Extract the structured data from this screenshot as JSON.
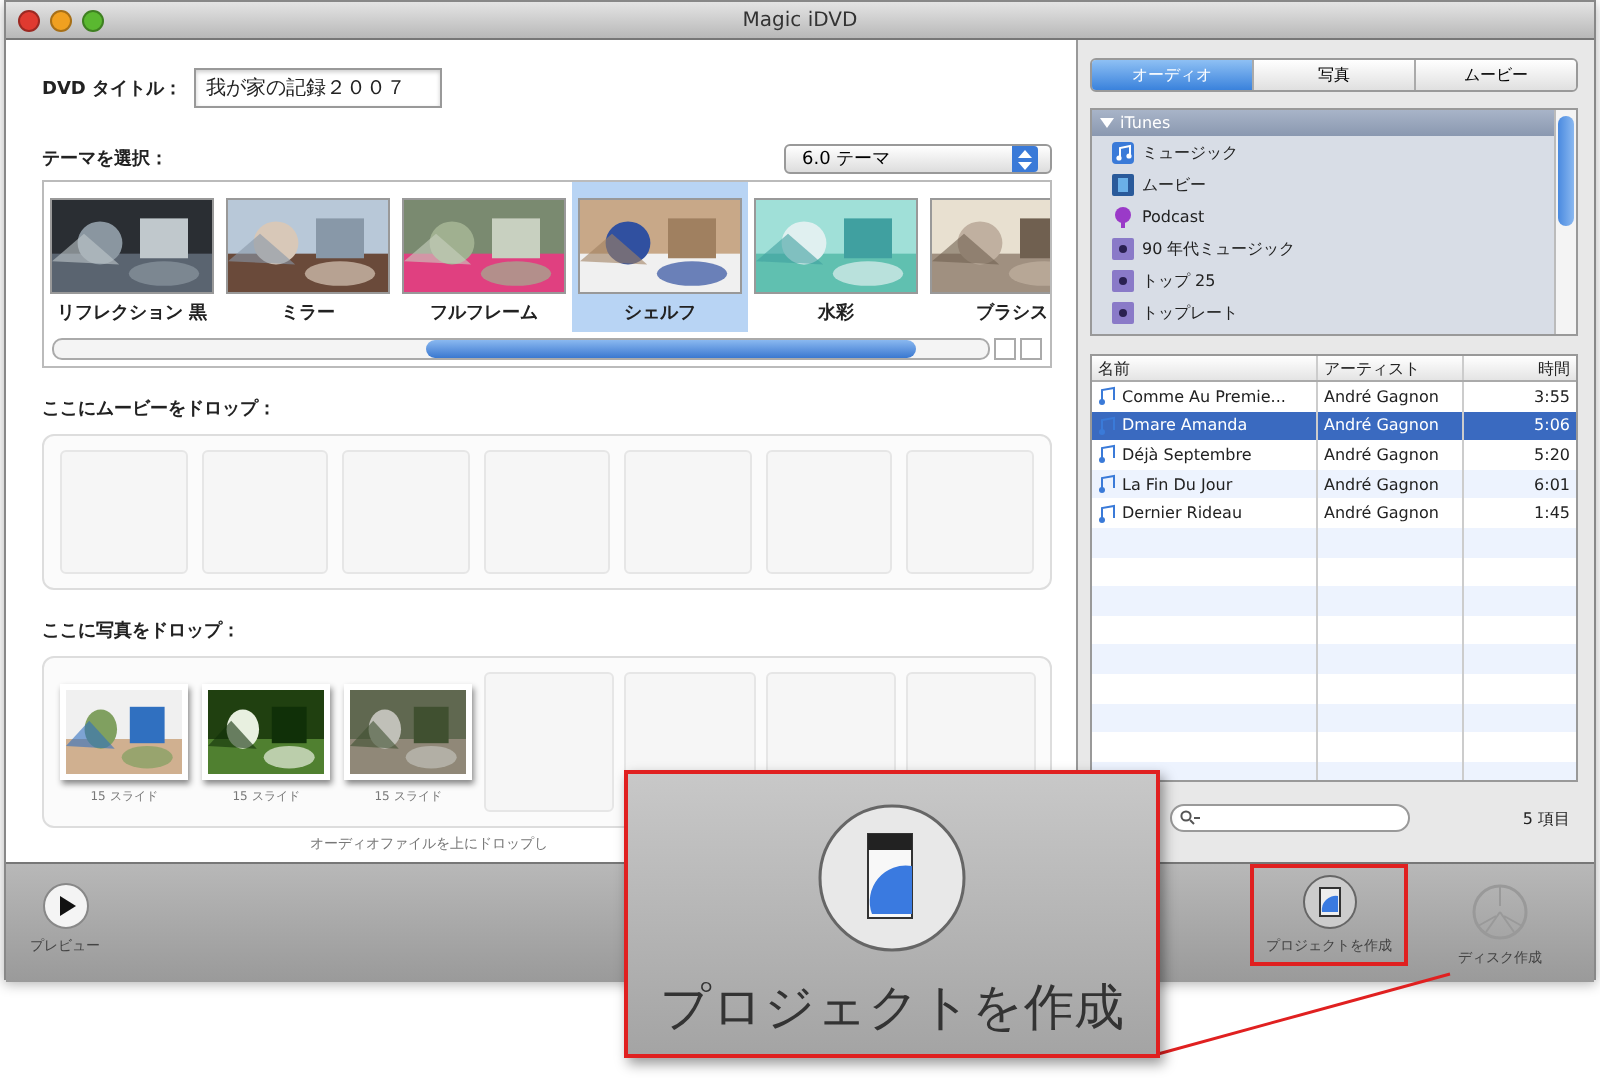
{
  "window": {
    "title": "Magic iDVD"
  },
  "dvd_title": {
    "label": "DVD タイトル：",
    "value": "我が家の記録２００７"
  },
  "theme": {
    "label": "テーマを選択：",
    "dropdown": "6.0 テーマ",
    "themes": [
      {
        "label": "リフレクション 黒",
        "selected": false
      },
      {
        "label": "ミラー",
        "selected": false
      },
      {
        "label": "フルフレーム",
        "selected": false
      },
      {
        "label": "シェルフ",
        "selected": true
      },
      {
        "label": "水彩",
        "selected": false
      },
      {
        "label": "ブラシス",
        "selected": false
      }
    ]
  },
  "movie_drop": {
    "label": "ここにムービーをドロップ："
  },
  "photo_drop": {
    "label": "ここに写真をドロップ：",
    "slides": [
      {
        "caption": "15 スライド"
      },
      {
        "caption": "15 スライド"
      },
      {
        "caption": "15 スライド"
      }
    ],
    "hint": "オーディオファイルを上にドロップし"
  },
  "media_tabs": [
    {
      "label": "オーディオ",
      "selected": true
    },
    {
      "label": "写真",
      "selected": false
    },
    {
      "label": "ムービー",
      "selected": false
    }
  ],
  "source_list": {
    "label": "iTunes",
    "expanded": true,
    "children": [
      {
        "label": "ミュージック",
        "kind": "music"
      },
      {
        "label": "ムービー",
        "kind": "movie"
      },
      {
        "label": "Podcast",
        "kind": "podcast"
      },
      {
        "label": "90 年代ミュージック",
        "kind": "playlist"
      },
      {
        "label": "トップ 25",
        "kind": "playlist"
      },
      {
        "label": "トップレート",
        "kind": "playlist"
      }
    ]
  },
  "table": {
    "columns": [
      "名前",
      "アーティスト",
      "時間"
    ],
    "rows": [
      {
        "cells": [
          "Comme Au Premie...",
          "André Gagnon",
          "3:55"
        ],
        "selected": false
      },
      {
        "cells": [
          "Dmare Amanda",
          "André Gagnon",
          "5:06"
        ],
        "selected": true
      },
      {
        "cells": [
          "Déjà Septembre",
          "André Gagnon",
          "5:20"
        ],
        "selected": false
      },
      {
        "cells": [
          "La Fin Du Jour",
          "André Gagnon",
          "6:01"
        ],
        "selected": false
      },
      {
        "cells": [
          "Dernier Rideau",
          "André Gagnon",
          "1:45"
        ],
        "selected": false
      }
    ]
  },
  "item_count": "5 項目",
  "toolbar": [
    {
      "label": "プレビュー",
      "kind": "preview",
      "highlighted": false
    },
    {
      "label": "プロジェクトを作成",
      "kind": "project",
      "highlighted": true
    },
    {
      "label": "ディスク作成",
      "kind": "disc",
      "highlighted": false
    }
  ],
  "callout": {
    "label": "プロジェクトを作成"
  }
}
